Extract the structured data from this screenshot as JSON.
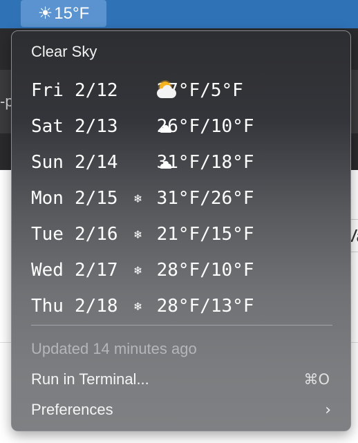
{
  "menubar": {
    "weather_icon": "sun-icon",
    "temperature": "15°F"
  },
  "background": {
    "left_fragment": "-p",
    "right_fragment": "Va"
  },
  "menu": {
    "title": "Clear Sky",
    "forecast": [
      {
        "day": "Fri",
        "date": "2/12",
        "icon": "partly-cloudy-icon",
        "temps": "27°F/5°F"
      },
      {
        "day": "Sat",
        "date": "2/13",
        "icon": "cloud-icon",
        "temps": "26°F/10°F"
      },
      {
        "day": "Sun",
        "date": "2/14",
        "icon": "cloud-icon",
        "temps": "31°F/18°F"
      },
      {
        "day": "Mon",
        "date": "2/15",
        "icon": "snowflake-icon",
        "temps": "31°F/26°F"
      },
      {
        "day": "Tue",
        "date": "2/16",
        "icon": "snowflake-icon",
        "temps": "21°F/15°F"
      },
      {
        "day": "Wed",
        "date": "2/17",
        "icon": "snowflake-icon",
        "temps": "28°F/10°F"
      },
      {
        "day": "Thu",
        "date": "2/18",
        "icon": "snowflake-icon",
        "temps": "28°F/13°F"
      }
    ],
    "updated": "Updated 14 minutes ago",
    "run_in_terminal": {
      "label": "Run in Terminal...",
      "shortcut": "⌘O"
    },
    "preferences": {
      "label": "Preferences",
      "submenu_indicator": "chevron-right-icon"
    }
  }
}
